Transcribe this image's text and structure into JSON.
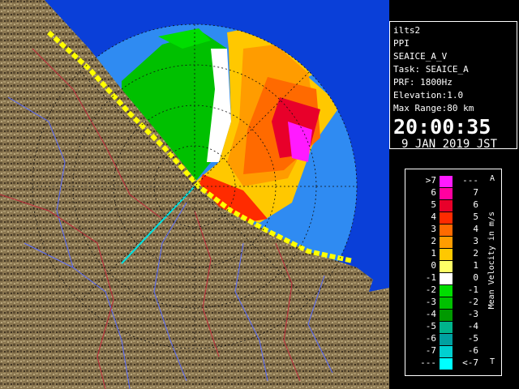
{
  "info_panel": {
    "site": "ilts2",
    "product": "PPI",
    "volume": "SEAICE_A_V",
    "task": "Task: SEAICE_A",
    "prf": "PRF: 1800Hz",
    "elevation": "Elevation:1.0",
    "max_range": "Max Range:80 km",
    "time": "20:00:35",
    "date": "9 JAN 2019 JST"
  },
  "legend": {
    "title": "Mean Velocity in m/s",
    "axis_top": "A",
    "axis_bottom": "T",
    "rows": [
      {
        "left": ">7",
        "right": "---",
        "color": "#ff1aff"
      },
      {
        "left": "6",
        "right": "7",
        "color": "#ff00a0"
      },
      {
        "left": "5",
        "right": "6",
        "color": "#e8002a"
      },
      {
        "left": "4",
        "right": "5",
        "color": "#ff2b00"
      },
      {
        "left": "3",
        "right": "4",
        "color": "#ff6a00"
      },
      {
        "left": "2",
        "right": "3",
        "color": "#ff9c00"
      },
      {
        "left": "1",
        "right": "2",
        "color": "#ffc800"
      },
      {
        "left": "0",
        "right": "1",
        "color": "#ffff66"
      },
      {
        "left": "-1",
        "right": "0",
        "color": "#ffffff"
      },
      {
        "left": "-2",
        "right": "-1",
        "color": "#00dd00"
      },
      {
        "left": "-3",
        "right": "-2",
        "color": "#00c000"
      },
      {
        "left": "-4",
        "right": "-3",
        "color": "#009900"
      },
      {
        "left": "-5",
        "right": "-4",
        "color": "#00b48c"
      },
      {
        "left": "-6",
        "right": "-5",
        "color": "#00a0a0"
      },
      {
        "left": "-7",
        "right": "-6",
        "color": "#00d0d0"
      },
      {
        "left": "---",
        "right": "<-7",
        "color": "#00ffff"
      }
    ]
  },
  "colors": {
    "sea": "#0a3fd8",
    "radar_range": "#2f8bf2",
    "land": "#8a7650",
    "rivers": "#5a6cff",
    "roads": "#c0283a"
  }
}
